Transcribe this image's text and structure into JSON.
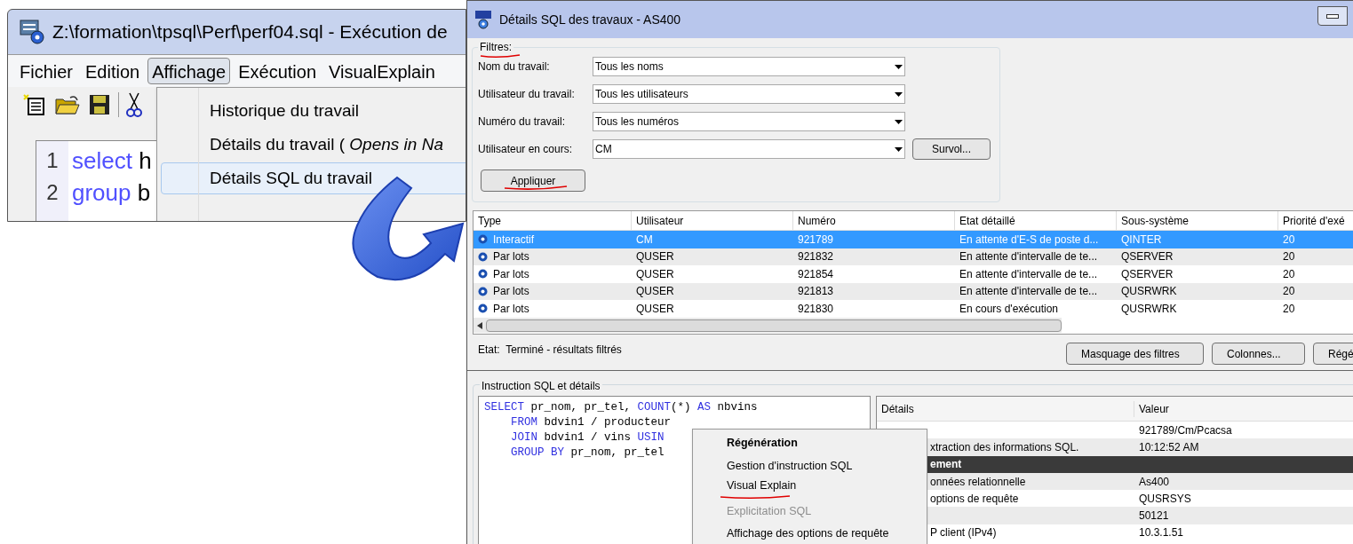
{
  "left_window": {
    "title": "Z:\\formation\\tpsql\\Perf\\perf04.sql - Exécution de",
    "menu": [
      {
        "label": "Fichier",
        "selected": false
      },
      {
        "label": "Edition",
        "selected": false
      },
      {
        "label": "Affichage",
        "selected": true
      },
      {
        "label": "Exécution",
        "selected": false
      },
      {
        "label": "VisualExplain",
        "selected": false
      }
    ],
    "editor_lines": [
      {
        "number": "1",
        "keyword": "select",
        "rest": "h"
      },
      {
        "number": "2",
        "keyword": "group",
        "rest": "b"
      }
    ],
    "dropdown": [
      {
        "label": "Historique du travail",
        "highlighted": false
      },
      {
        "label": "Détails du travail ( *Opens in Na*",
        "highlighted": false
      },
      {
        "label": "Détails SQL du travail",
        "highlighted": true
      }
    ]
  },
  "right_window": {
    "title": "Détails SQL des travaux - AS400",
    "filters": {
      "title": "Filtres:",
      "annotated": true,
      "fields": [
        {
          "label": "Nom du travail:",
          "value": "Tous les noms"
        },
        {
          "label": "Utilisateur du travail:",
          "value": "Tous les utilisateurs"
        },
        {
          "label": "Numéro du travail:",
          "value": "Tous les numéros"
        },
        {
          "label": "Utilisateur en cours:",
          "value": "CM"
        }
      ],
      "browse_button": "Survol...",
      "apply_button": {
        "label": "Appliquer",
        "annotated": true
      }
    },
    "table": {
      "columns": [
        "Type",
        "Utilisateur",
        "Numéro",
        "Etat détaillé",
        "Sous-système",
        "Priorité d'exé"
      ],
      "rows": [
        {
          "cells": [
            "Interactif",
            "CM",
            "921789",
            "En attente d'E-S de poste d...",
            "QINTER",
            "20"
          ],
          "selected": true
        },
        {
          "cells": [
            "Par lots",
            "QUSER",
            "921832",
            "En attente d'intervalle de te...",
            "QSERVER",
            "20"
          ],
          "selected": false
        },
        {
          "cells": [
            "Par lots",
            "QUSER",
            "921854",
            "En attente d'intervalle de te...",
            "QSERVER",
            "20"
          ],
          "selected": false
        },
        {
          "cells": [
            "Par lots",
            "QUSER",
            "921813",
            "En attente d'intervalle de te...",
            "QUSRWRK",
            "20"
          ],
          "selected": false
        },
        {
          "cells": [
            "Par lots",
            "QUSER",
            "921830",
            "En cours d'exécution",
            "QUSRWRK",
            "20"
          ],
          "selected": false
        }
      ]
    },
    "status": "Etat:  Terminé - résultats filtrés",
    "buttons": [
      "Masquage des filtres",
      "Colonnes...",
      "Régé"
    ],
    "sql_panel": {
      "title": "Instruction SQL et détails",
      "sql_lines": [
        [
          {
            "text": "SELECT",
            "kind": "keyword"
          },
          {
            "text": " pr_nom, pr_tel, ",
            "kind": "plain"
          },
          {
            "text": "COUNT",
            "kind": "keyword"
          },
          {
            "text": "(*) ",
            "kind": "plain"
          },
          {
            "text": "AS",
            "kind": "keyword"
          },
          {
            "text": " nbvins",
            "kind": "plain"
          }
        ],
        [
          {
            "text": "FROM",
            "kind": "keyword",
            "indented": true
          },
          {
            "text": " bdvin1 / producteur",
            "kind": "plain"
          }
        ],
        [
          {
            "text": "JOIN",
            "kind": "keyword",
            "indented": true
          },
          {
            "text": " bdvin1 / vins ",
            "kind": "plain"
          },
          {
            "text": "USIN",
            "kind": "keyword"
          }
        ],
        [
          {
            "text": "GROUP BY",
            "kind": "keyword",
            "indented": true
          },
          {
            "text": " pr_nom, pr_tel",
            "kind": "plain"
          }
        ]
      ],
      "details_columns": [
        "Détails",
        "Valeur"
      ],
      "details_rows": [
        {
          "kind": "row",
          "value": "921789/Cm/Pcacsa"
        },
        {
          "kind": "row",
          "detail": "xtraction des informations SQL.",
          "value": "10:12:52 AM"
        },
        {
          "kind": "header",
          "detail": "ement"
        },
        {
          "kind": "row",
          "detail": "onnées relationnelle",
          "value": "As400"
        },
        {
          "kind": "row",
          "detail": "options de requête",
          "value": "QUSRSYS"
        },
        {
          "kind": "row",
          "value": "50121"
        },
        {
          "kind": "row",
          "detail": "P client (IPv4)",
          "value": "10.3.1.51"
        }
      ]
    },
    "context_menu": [
      {
        "label": "Régénération",
        "default": true,
        "disabled": false,
        "annotated": false
      },
      {
        "label": "Gestion d'instruction SQL",
        "default": false,
        "disabled": false,
        "annotated": false
      },
      {
        "label": "Visual Explain",
        "default": false,
        "disabled": false,
        "annotated": true
      },
      {
        "label": "Explicitation SQL",
        "default": false,
        "disabled": true,
        "annotated": false
      },
      {
        "label": "Affichage des options de requête",
        "default": false,
        "disabled": false,
        "annotated": false
      }
    ]
  }
}
